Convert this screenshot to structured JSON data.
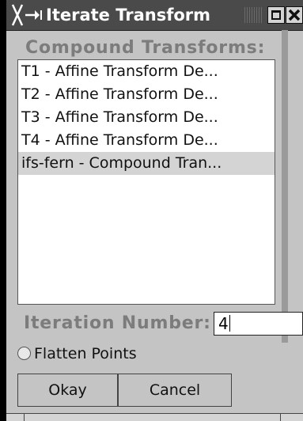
{
  "window": {
    "title": "Iterate Transform",
    "icons": [
      "x-window-logo-icon",
      "maximize-icon",
      "close-icon"
    ]
  },
  "compound_section": {
    "label": "Compound Transforms:",
    "items": [
      {
        "label": "T1 - Affine Transform De...",
        "selected": false
      },
      {
        "label": "T2 - Affine Transform De...",
        "selected": false
      },
      {
        "label": "T3 - Affine Transform De...",
        "selected": false
      },
      {
        "label": "T4 - Affine Transform De...",
        "selected": false
      },
      {
        "label": "ifs-fern - Compound Tran...",
        "selected": true
      }
    ]
  },
  "iteration": {
    "label": "Iteration Number:",
    "value": "4"
  },
  "flatten": {
    "label": "Flatten Points",
    "checked": false
  },
  "buttons": {
    "okay": "Okay",
    "cancel": "Cancel"
  },
  "colors": {
    "background": "#c4c4c4",
    "titlebar": "#4a4a4a",
    "selection": "#d4d4d4",
    "label_text": "#7c7c7c"
  }
}
